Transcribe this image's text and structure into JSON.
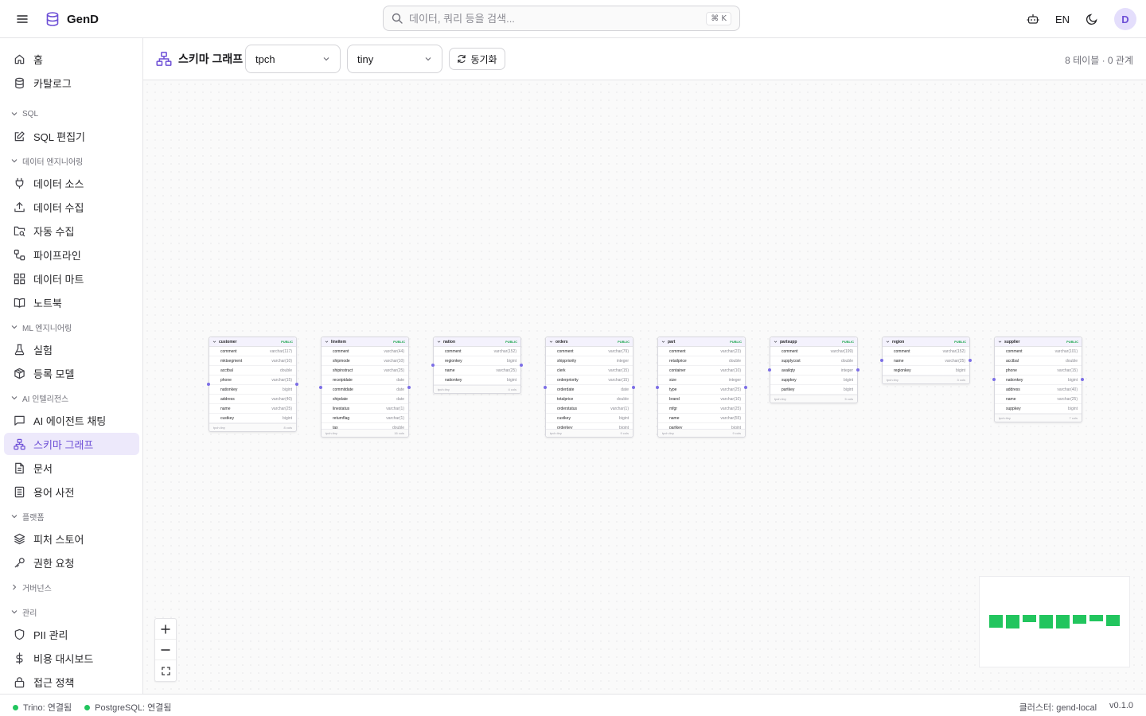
{
  "app": {
    "name": "GenD",
    "search_placeholder": "데이터, 쿼리 등을 검색...",
    "search_shortcut": "⌘ K",
    "lang": "EN",
    "avatar": "D",
    "accent": "#6d4fd6"
  },
  "sidebar": {
    "home": "홈",
    "catalog": "카탈로그",
    "sec_sql": "SQL",
    "sql_editor": "SQL 편집기",
    "sec_data_eng": "데이터 엔지니어링",
    "data_source": "데이터 소스",
    "data_ingest": "데이터 수집",
    "auto_ingest": "자동 수집",
    "pipeline": "파이프라인",
    "data_mart": "데이터 마트",
    "notebook": "노트북",
    "sec_ml": "ML 엔지니어링",
    "experiment": "실험",
    "registered_model": "등록 모델",
    "sec_ai": "AI 인텔리전스",
    "ai_agent_chat": "AI 에이전트 채팅",
    "schema_graph": "스키마 그래프",
    "documents": "문서",
    "glossary": "용어 사전",
    "sec_platform": "플랫폼",
    "feature_store": "피처 스토어",
    "access_request": "권한 요청",
    "sec_governance": "거버넌스",
    "sec_admin": "관리",
    "pii_mgmt": "PII 관리",
    "cost_dashboard": "비용 대시보드",
    "access_policy": "접근 정책"
  },
  "header": {
    "title": "스키마 그래프",
    "catalog_select": "tpch",
    "schema_select": "tiny",
    "sync_label": "동기화",
    "stats": "8 테이블 · 0 관계"
  },
  "tables": [
    {
      "name": "customer",
      "badge": "PUBLIC",
      "schema": "tpch.tiny",
      "cols_label": "8 cols",
      "columns": [
        {
          "name": "comment",
          "type": "varchar(117)"
        },
        {
          "name": "mktsegment",
          "type": "varchar(10)"
        },
        {
          "name": "acctbal",
          "type": "double"
        },
        {
          "name": "phone",
          "type": "varchar(15)"
        },
        {
          "name": "nationkey",
          "type": "bigint"
        },
        {
          "name": "address",
          "type": "varchar(40)"
        },
        {
          "name": "name",
          "type": "varchar(25)"
        },
        {
          "name": "custkey",
          "type": "bigint"
        }
      ]
    },
    {
      "name": "lineitem",
      "badge": "PUBLIC",
      "schema": "tpch.tiny",
      "cols_label": "16 cols",
      "columns": [
        {
          "name": "comment",
          "type": "varchar(44)"
        },
        {
          "name": "shipmode",
          "type": "varchar(10)"
        },
        {
          "name": "shipinstruct",
          "type": "varchar(25)"
        },
        {
          "name": "receiptdate",
          "type": "date"
        },
        {
          "name": "commitdate",
          "type": "date"
        },
        {
          "name": "shipdate",
          "type": "date"
        },
        {
          "name": "linestatus",
          "type": "varchar(1)"
        },
        {
          "name": "returnflag",
          "type": "varchar(1)"
        },
        {
          "name": "tax",
          "type": "double"
        }
      ]
    },
    {
      "name": "nation",
      "badge": "PUBLIC",
      "schema": "tpch.tiny",
      "cols_label": "4 cols",
      "columns": [
        {
          "name": "comment",
          "type": "varchar(152)"
        },
        {
          "name": "regionkey",
          "type": "bigint"
        },
        {
          "name": "name",
          "type": "varchar(25)"
        },
        {
          "name": "nationkey",
          "type": "bigint"
        }
      ]
    },
    {
      "name": "orders",
      "badge": "PUBLIC",
      "schema": "tpch.tiny",
      "cols_label": "9 cols",
      "columns": [
        {
          "name": "comment",
          "type": "varchar(79)"
        },
        {
          "name": "shippriority",
          "type": "integer"
        },
        {
          "name": "clerk",
          "type": "varchar(15)"
        },
        {
          "name": "orderpriority",
          "type": "varchar(15)"
        },
        {
          "name": "orderdate",
          "type": "date"
        },
        {
          "name": "totalprice",
          "type": "double"
        },
        {
          "name": "orderstatus",
          "type": "varchar(1)"
        },
        {
          "name": "custkey",
          "type": "bigint"
        },
        {
          "name": "orderkey",
          "type": "bigint"
        }
      ]
    },
    {
      "name": "part",
      "badge": "PUBLIC",
      "schema": "tpch.tiny",
      "cols_label": "9 cols",
      "columns": [
        {
          "name": "comment",
          "type": "varchar(23)"
        },
        {
          "name": "retailprice",
          "type": "double"
        },
        {
          "name": "container",
          "type": "varchar(10)"
        },
        {
          "name": "size",
          "type": "integer"
        },
        {
          "name": "type",
          "type": "varchar(25)"
        },
        {
          "name": "brand",
          "type": "varchar(10)"
        },
        {
          "name": "mfgr",
          "type": "varchar(25)"
        },
        {
          "name": "name",
          "type": "varchar(55)"
        },
        {
          "name": "partkey",
          "type": "bigint"
        }
      ]
    },
    {
      "name": "partsupp",
      "badge": "PUBLIC",
      "schema": "tpch.tiny",
      "cols_label": "5 cols",
      "columns": [
        {
          "name": "comment",
          "type": "varchar(199)"
        },
        {
          "name": "supplycost",
          "type": "double"
        },
        {
          "name": "availqty",
          "type": "integer"
        },
        {
          "name": "suppkey",
          "type": "bigint"
        },
        {
          "name": "partkey",
          "type": "bigint"
        }
      ]
    },
    {
      "name": "region",
      "badge": "PUBLIC",
      "schema": "tpch.tiny",
      "cols_label": "3 cols",
      "columns": [
        {
          "name": "comment",
          "type": "varchar(152)"
        },
        {
          "name": "name",
          "type": "varchar(25)"
        },
        {
          "name": "regionkey",
          "type": "bigint"
        }
      ]
    },
    {
      "name": "supplier",
      "badge": "PUBLIC",
      "schema": "tpch.tiny",
      "cols_label": "7 cols",
      "columns": [
        {
          "name": "comment",
          "type": "varchar(101)"
        },
        {
          "name": "acctbal",
          "type": "double"
        },
        {
          "name": "phone",
          "type": "varchar(15)"
        },
        {
          "name": "nationkey",
          "type": "bigint"
        },
        {
          "name": "address",
          "type": "varchar(40)"
        },
        {
          "name": "name",
          "type": "varchar(25)"
        },
        {
          "name": "suppkey",
          "type": "bigint"
        }
      ]
    }
  ],
  "status": {
    "trino": "Trino: 연결됨",
    "postgres": "PostgreSQL: 연결됨",
    "cluster": "클러스터: gend-local",
    "version": "v0.1.0",
    "ok_color": "#22c55e"
  }
}
